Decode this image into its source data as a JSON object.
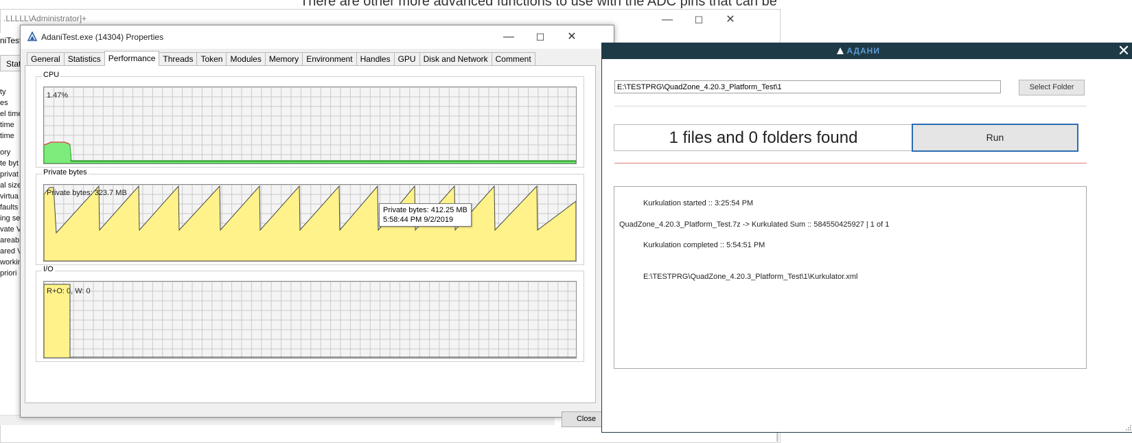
{
  "background": {
    "doc_text": "There are other more advanced functions to use with the ADC pins that can be",
    "window2_title": ".LLLLL\\Administrator]+",
    "window2_controls": [
      "—",
      "☐",
      "✕"
    ],
    "left_tab_label": "Stati",
    "left_side_labels": [
      "ty",
      "es",
      "el time",
      "time",
      "time",
      "ory",
      "te byt",
      "privat",
      "al size",
      "virtua",
      "faults",
      "ing se",
      "vate V",
      "areab",
      "ared V",
      "workin",
      "priori"
    ],
    "left_side_tab2": "niTest."
  },
  "properties": {
    "title": "AdaniTest.exe (14304) Properties",
    "window_controls": [
      "—",
      "☐",
      "✕"
    ],
    "tabs": [
      "General",
      "Statistics",
      "Performance",
      "Threads",
      "Token",
      "Modules",
      "Memory",
      "Environment",
      "Handles",
      "GPU",
      "Disk and Network",
      "Comment"
    ],
    "active_tab": "Performance",
    "cpu": {
      "label": "CPU",
      "readout": "1.47%"
    },
    "private_bytes": {
      "label": "Private bytes",
      "readout": "Private bytes: 323.7 MB",
      "tooltip_line1": "Private bytes: 412.25 MB",
      "tooltip_line2": "5:58:44 PM 9/2/2019"
    },
    "io": {
      "label": "I/O",
      "readout": "R+O: 0, W: 0"
    },
    "close_label": "Close",
    "colors": {
      "cpu_fill": "#7dec7d",
      "cpu_kernel": "#e05050",
      "mem_fill": "#fff28a",
      "io_fill": "#fff28a",
      "grid": "#c9c9c9"
    }
  },
  "adani": {
    "brand": "АДАНИ",
    "close_icon": "✕",
    "folder_path": "E:\\TESTPRG\\QuadZone_4.20.3_Platform_Test\\1",
    "select_folder_label": "Select Folder",
    "found_text": "1 files and 0 folders found",
    "run_label": "Run",
    "log": [
      "Kurkulation started :: 3:25:54 PM",
      "QuadZone_4.20.3_Platform_Test.7z -> Kurkulated Sum :: 584550425927 | 1 of 1",
      "Kurkulation completed :: 5:54:51 PM",
      "E:\\TESTPRG\\QuadZone_4.20.3_Platform_Test\\1\\Kurkulator.xml"
    ],
    "colors": {
      "titlebar": "#1e3a47",
      "brand": "#5c9bd5",
      "accent_line": "#e07a7a",
      "run_border": "#2b6cb3"
    }
  }
}
